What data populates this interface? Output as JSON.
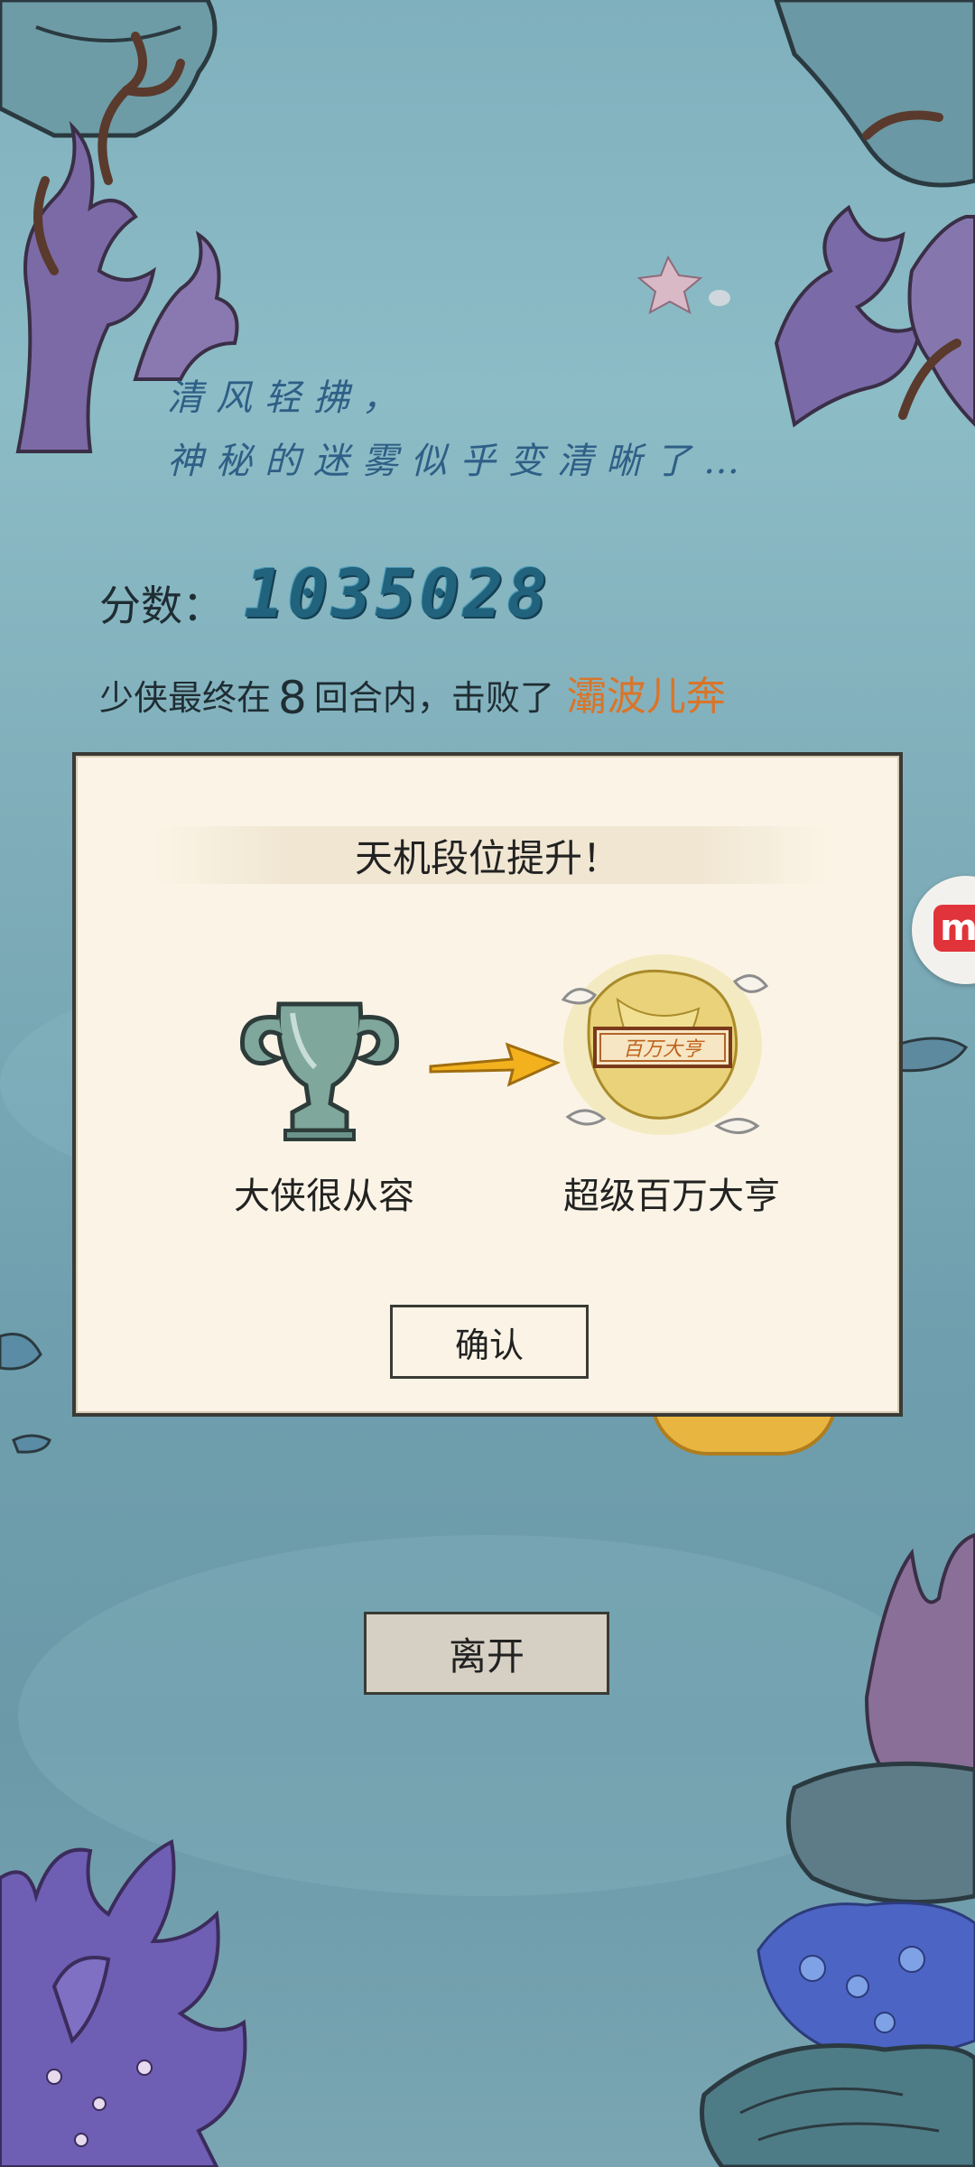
{
  "poem": {
    "line1": "清风轻拂，",
    "line2": "神秘的迷雾似乎变清晰了…"
  },
  "score": {
    "label": "分数：",
    "value": "1035028"
  },
  "result": {
    "prefix": "少侠最终在",
    "rounds": "8",
    "middle": "回合内，击败了",
    "enemy": "灞波儿奔"
  },
  "dialog": {
    "title": "天机段位提升！",
    "old_rank": "大侠很从容",
    "new_rank": "超级百万大亨",
    "new_rank_plaque": "百万大亨",
    "confirm_label": "确认"
  },
  "leave_label": "离开",
  "side_badge_text": "m",
  "colors": {
    "enemy_accent": "#d9752a",
    "score_blue": "#21627d",
    "dialog_bg": "#fbf4e6"
  },
  "icons": {
    "old_rank": "jade-trophy-icon",
    "arrow": "arrow-right-icon",
    "new_rank": "golden-dragon-plaque-icon"
  }
}
